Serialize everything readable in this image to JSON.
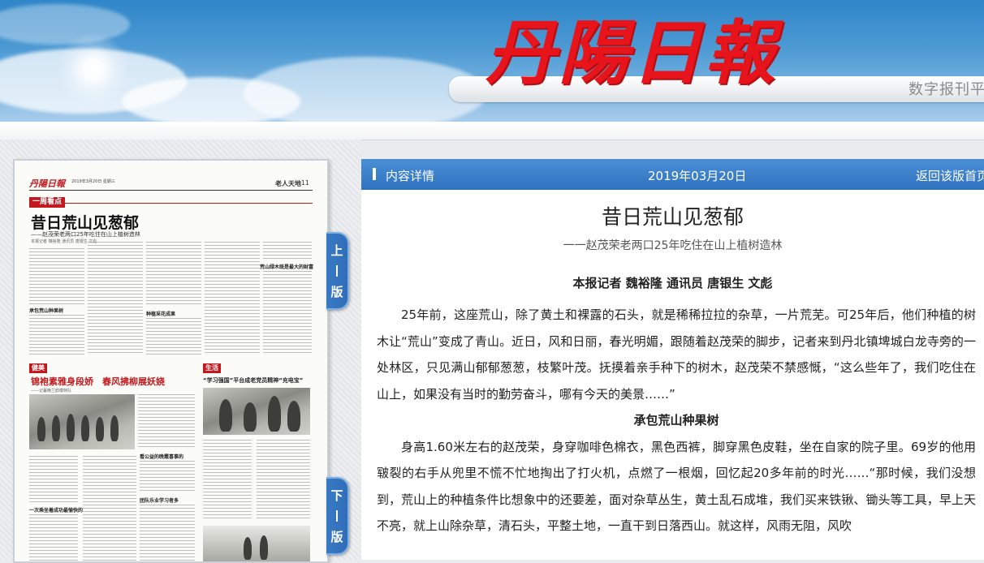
{
  "header": {
    "logo": "丹陽日報",
    "tagline": "数字报刊平台"
  },
  "newspaper_page": {
    "masthead": "丹陽日報",
    "date_line": "2019年3月20日 星期三",
    "section": "老人天地",
    "page_number": "11",
    "tag1": "一周看点",
    "headline": "昔日荒山见葱郁",
    "subheadline": "——赵茂荣老两口25年吃住在山上植树造林",
    "byline": "本报记者 魏裕隆 通讯员 唐银生 文彪",
    "subhead1": "承包荒山种果树",
    "subhead2": "种植采花成果",
    "subhead3": "荒山绿木既是最大的财富",
    "tag2": "健美",
    "headline2": "锦袍素雅身段娇　春风拂柳展妖娆",
    "sub2": "——记暮晚兰韵模特队",
    "tag3": "生活",
    "headline3": "“学习强国”平台成老党员精神“充电宝”",
    "subhead4": "看公益的晚霞喜事的",
    "subhead5": "一次乘坐着成功最愉快的",
    "subhead6": "团队乐业学习者多"
  },
  "nav": {
    "prev_label_1": "上",
    "prev_label_2": "版",
    "next_label_1": "下",
    "next_label_2": "版"
  },
  "content_bar": {
    "title": "内容详情",
    "date": "2019年03月20日",
    "back_link": "返回该版首页"
  },
  "article": {
    "title": "昔日荒山见葱郁",
    "subtitle": "一一赵茂荣老两口25年吃住在山上植树造林",
    "byline": "本报记者 魏裕隆 通讯员 唐银生 文彪",
    "paragraph1": "25年前，这座荒山，除了黄土和裸露的石头，就是稀稀拉拉的杂草，一片荒芜。可25年后，他们种植的树木让“荒山”变成了青山。近日，风和日丽，春光明媚，跟随着赵茂荣的脚步，记者来到丹北镇埤城白龙寺旁的一处林区，只见满山郁郁葱葱，枝繁叶茂。抚摸着亲手种下的树木，赵茂荣不禁感慨，“这么些年了，我们吃住在山上，如果没有当时的勤劳奋斗，哪有今天的美景……”",
    "section_heading": "承包荒山种果树",
    "paragraph2": "身高1.60米左右的赵茂荣，身穿咖啡色棉衣，黑色西裤，脚穿黑色皮鞋，坐在自家的院子里。69岁的他用皲裂的右手从兜里不慌不忙地掏出了打火机，点燃了一根烟，回忆起20多年前的时光……“那时候，我们没想到，荒山上的种植条件比想象中的还要差，面对杂草丛生，黄土乱石成堆，我们买来铁锹、锄头等工具，早上天不亮，就上山除杂草，清石头，平整土地，一直干到日落西山。就这样，风雨无阻，风吹"
  },
  "colors": {
    "bar_blue": "#3a80cc",
    "logo_red": "#e8141b",
    "tab_blue": "#2f6db8"
  }
}
